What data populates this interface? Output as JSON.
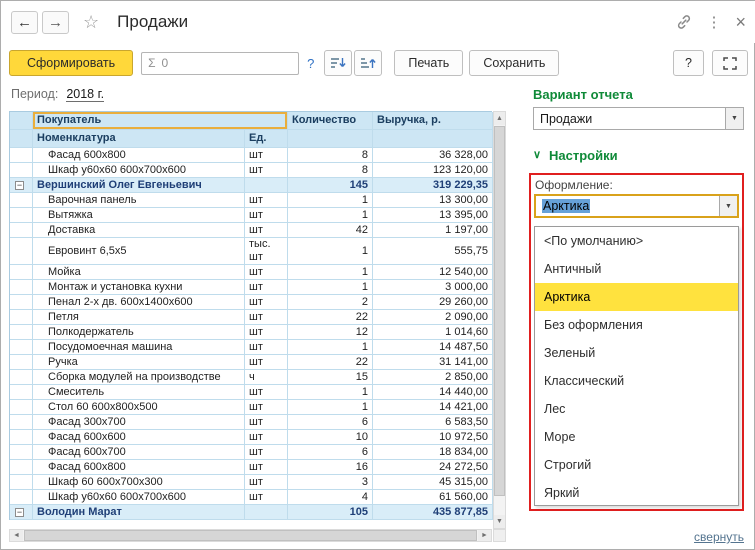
{
  "window": {
    "title": "Продажи"
  },
  "icons": {
    "back": "←",
    "forward": "→",
    "star": "☆",
    "menu_dots": "⋮",
    "close": "×",
    "sigma": "Σ",
    "help": "?",
    "dropdown": "▼",
    "collapse": "−",
    "chevron_settings": "∨",
    "scroll_up": "▲",
    "scroll_down": "▼",
    "scroll_left": "◄",
    "scroll_right": "►"
  },
  "toolbar": {
    "generate_label": "Сформировать",
    "sum_value": "0",
    "help_link": "?",
    "print_label": "Печать",
    "save_label": "Сохранить",
    "panel_help": "?"
  },
  "period": {
    "label": "Период:",
    "value": "2018 г."
  },
  "table": {
    "header": {
      "buyer": "Покупатель",
      "nomenclature": "Номенклатура",
      "unit": "Ед.",
      "quantity": "Количество",
      "revenue": "Выручка, р."
    },
    "rows": [
      {
        "type": "item",
        "name": "Фасад 600x800",
        "unit": "шт",
        "qty": "8",
        "revenue": "36 328,00"
      },
      {
        "type": "item",
        "name": "Шкаф у60х60 600х700х600",
        "unit": "шт",
        "qty": "8",
        "revenue": "123 120,00"
      },
      {
        "type": "group",
        "name": "Вершинский Олег Евгеньевич",
        "unit": "",
        "qty": "145",
        "revenue": "319 229,35"
      },
      {
        "type": "item",
        "name": "Варочная панель",
        "unit": "шт",
        "qty": "1",
        "revenue": "13 300,00"
      },
      {
        "type": "item",
        "name": "Вытяжка",
        "unit": "шт",
        "qty": "1",
        "revenue": "13 395,00"
      },
      {
        "type": "item",
        "name": "Доставка",
        "unit": "шт",
        "qty": "42",
        "revenue": "1 197,00"
      },
      {
        "type": "item",
        "name": "Евровинт 6,5х5",
        "unit": "тыс. шт",
        "qty": "1",
        "revenue": "555,75"
      },
      {
        "type": "item",
        "name": "Мойка",
        "unit": "шт",
        "qty": "1",
        "revenue": "12 540,00"
      },
      {
        "type": "item",
        "name": "Монтаж и установка кухни",
        "unit": "шт",
        "qty": "1",
        "revenue": "3 000,00"
      },
      {
        "type": "item",
        "name": "Пенал 2-х дв. 600х1400х600",
        "unit": "шт",
        "qty": "2",
        "revenue": "29 260,00"
      },
      {
        "type": "item",
        "name": "Петля",
        "unit": "шт",
        "qty": "22",
        "revenue": "2 090,00"
      },
      {
        "type": "item",
        "name": "Полкодержатель",
        "unit": "шт",
        "qty": "12",
        "revenue": "1 014,60"
      },
      {
        "type": "item",
        "name": "Посудомоечная машина",
        "unit": "шт",
        "qty": "1",
        "revenue": "14 487,50"
      },
      {
        "type": "item",
        "name": "Ручка",
        "unit": "шт",
        "qty": "22",
        "revenue": "31 141,00"
      },
      {
        "type": "item",
        "name": "Сборка модулей на производстве",
        "unit": "ч",
        "qty": "15",
        "revenue": "2 850,00"
      },
      {
        "type": "item",
        "name": "Смеситель",
        "unit": "шт",
        "qty": "1",
        "revenue": "14 440,00"
      },
      {
        "type": "item",
        "name": "Стол 60 600х800х500",
        "unit": "шт",
        "qty": "1",
        "revenue": "14 421,00"
      },
      {
        "type": "item",
        "name": "Фасад 300х700",
        "unit": "шт",
        "qty": "6",
        "revenue": "6 583,50"
      },
      {
        "type": "item",
        "name": "Фасад 600х600",
        "unit": "шт",
        "qty": "10",
        "revenue": "10 972,50"
      },
      {
        "type": "item",
        "name": "Фасад 600х700",
        "unit": "шт",
        "qty": "6",
        "revenue": "18 834,00"
      },
      {
        "type": "item",
        "name": "Фасад 600х800",
        "unit": "шт",
        "qty": "16",
        "revenue": "24 272,50"
      },
      {
        "type": "item",
        "name": "Шкаф 60 600х700х300",
        "unit": "шт",
        "qty": "3",
        "revenue": "45 315,00"
      },
      {
        "type": "item",
        "name": "Шкаф у60х60 600х700х600",
        "unit": "шт",
        "qty": "4",
        "revenue": "61 560,00"
      },
      {
        "type": "group",
        "name": "Володин Марат",
        "unit": "",
        "qty": "105",
        "revenue": "435 877,85"
      }
    ]
  },
  "right_panel": {
    "variant_title": "Вариант отчета",
    "variant_value": "Продажи",
    "settings_title": "Настройки",
    "style_label": "Оформление:",
    "style_value": "Арктика",
    "selected_option": "Арктика",
    "dropdown_options": [
      "<По умолчанию>",
      "Античный",
      "Арктика",
      "Без оформления",
      "Зеленый",
      "Классический",
      "Лес",
      "Море",
      "Строгий",
      "Яркий"
    ],
    "collapse_link": "свернуть"
  },
  "colors": {
    "accent_yellow": "#FFD83A",
    "header_blue": "#CDE6F4",
    "group_blue": "#D9EDF8",
    "green_title": "#0F8A38",
    "highlight_red": "#E01F1F",
    "option_highlight": "#FFE23E"
  }
}
